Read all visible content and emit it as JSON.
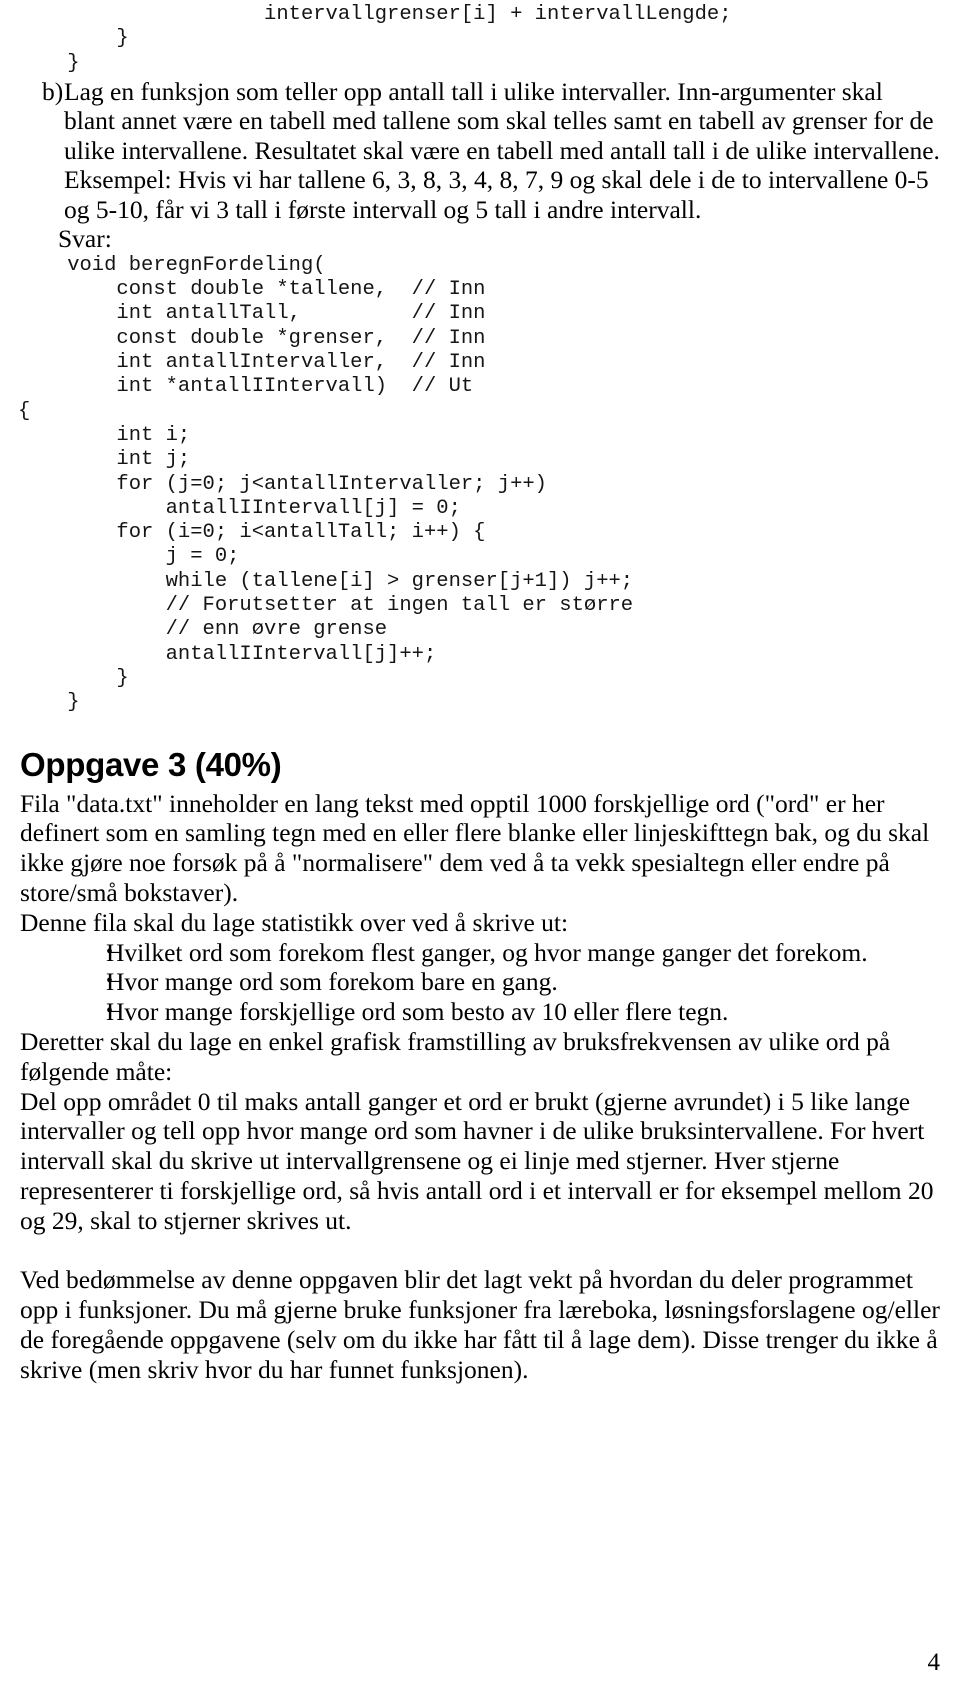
{
  "document": {
    "code_top": "                    intervallgrenser[i] + intervallLengde;\n        }\n    }",
    "task": {
      "marker": "b)",
      "text": "Lag en funksjon som teller opp antall tall i ulike intervaller. Inn-argumenter skal blant annet være en tabell med tallene som skal telles samt en tabell av grenser for de ulike intervallene. Resultatet skal være en tabell med antall tall i de ulike intervallene. Eksempel: Hvis vi har tallene 6, 3, 8, 3, 4, 8, 7, 9 og skal dele i de to intervallene 0-5 og 5-10, får vi 3 tall i første intervall og 5 tall i andre intervall."
    },
    "svar_label": "Svar:",
    "code_main": "    void beregnFordeling(\n        const double *tallene,  // Inn\n        int antallTall,         // Inn\n        const double *grenser,  // Inn\n        int antallIntervaller,  // Inn\n        int *antallIIntervall)  // Ut\n{\n        int i;\n        int j;\n        for (j=0; j<antallIntervaller; j++)\n            antallIIntervall[j] = 0;\n        for (i=0; i<antallTall; i++) {\n            j = 0;\n            while (tallene[i] > grenser[j+1]) j++;\n            // Forutsetter at ingen tall er større\n            // enn øvre grense\n            antallIIntervall[j]++;\n        }\n    }",
    "heading": "Oppgave 3 (40%)",
    "intro_paragraph": "Fila \"data.txt\" inneholder en lang tekst med opptil 1000 forskjellige ord (\"ord\" er her definert som en samling tegn med en eller flere blanke eller linjeskifttegn bak, og du skal ikke gjøre noe forsøk på å \"normalisere\" dem ved å ta vekk spesialtegn eller endre på store/små bokstaver).",
    "statistics_lead": "Denne fila skal du lage statistikk over ved å skrive ut:",
    "bullet_symbol": "•",
    "bullets": [
      "Hvilket ord som forekom flest ganger, og hvor mange ganger det forekom.",
      "Hvor mange ord som forekom bare en gang.",
      "Hvor mange forskjellige ord som besto av 10 eller flere tegn."
    ],
    "graphics_lead": "Deretter skal du lage en enkel grafisk framstilling av bruksfrekvensen av ulike ord på følgende måte:",
    "graphics_detail": "Del opp området 0 til maks antall ganger et ord er brukt (gjerne avrundet) i 5 like lange intervaller og tell opp hvor mange ord som havner i de ulike bruksintervallene. For hvert intervall skal du skrive ut intervallgrensene og ei linje med stjerner. Hver stjerne representerer ti forskjellige ord, så hvis antall ord i et intervall er for eksempel mellom 20 og 29, skal to stjerner skrives ut.",
    "assessment_paragraph": "Ved bedømmelse av denne oppgaven blir det lagt vekt på hvordan du deler programmet opp i funksjoner. Du må gjerne bruke funksjoner fra læreboka, løsningsforslagene og/eller de foregående oppgavene (selv om du ikke har fått til å lage dem). Disse trenger du ikke å skrive (men skriv hvor du har funnet funksjonen).",
    "page_number": "4"
  }
}
